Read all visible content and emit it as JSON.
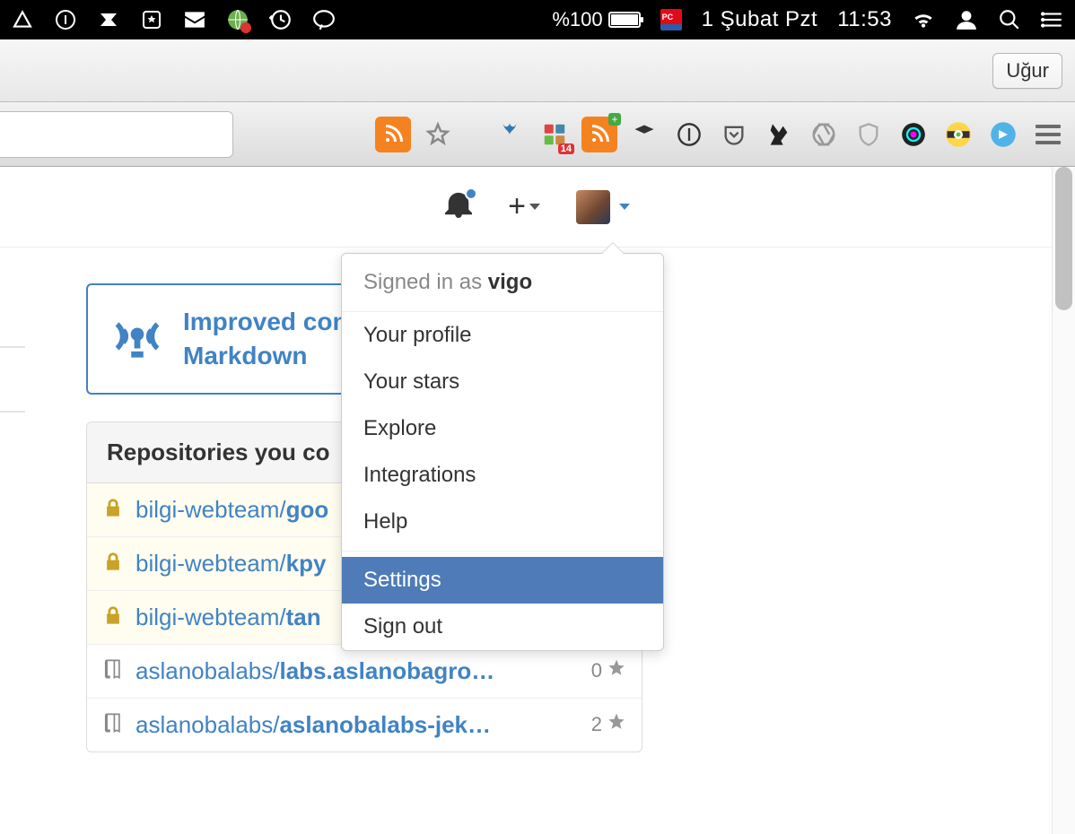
{
  "menubar": {
    "battery_pct": "%100",
    "date": "1 Şubat Pzt",
    "time": "11:53"
  },
  "titlebar": {
    "user_button": "Uğur"
  },
  "browser": {
    "ext_badge": "14"
  },
  "dropdown": {
    "signed_in_prefix": "Signed in as ",
    "signed_in_user": "vigo",
    "items_top": [
      "Your profile",
      "Your stars",
      "Explore",
      "Integrations",
      "Help"
    ],
    "settings": "Settings",
    "signout": "Sign out"
  },
  "announce": {
    "line1": "Improved com",
    "line2": "Markdown"
  },
  "repo_box": {
    "heading": "Repositories you co",
    "rows": [
      {
        "private": true,
        "owner": "bilgi-webteam/",
        "name": "goo",
        "stars": null
      },
      {
        "private": true,
        "owner": "bilgi-webteam/",
        "name": "kpy",
        "stars": null
      },
      {
        "private": true,
        "owner": "bilgi-webteam/",
        "name": "tan",
        "stars": null
      },
      {
        "private": false,
        "owner": "aslanobalabs/",
        "name": "labs.aslanobagro…",
        "stars": "0"
      },
      {
        "private": false,
        "owner": "aslanobalabs/",
        "name": "aslanobalabs-jek…",
        "stars": "2"
      }
    ]
  }
}
